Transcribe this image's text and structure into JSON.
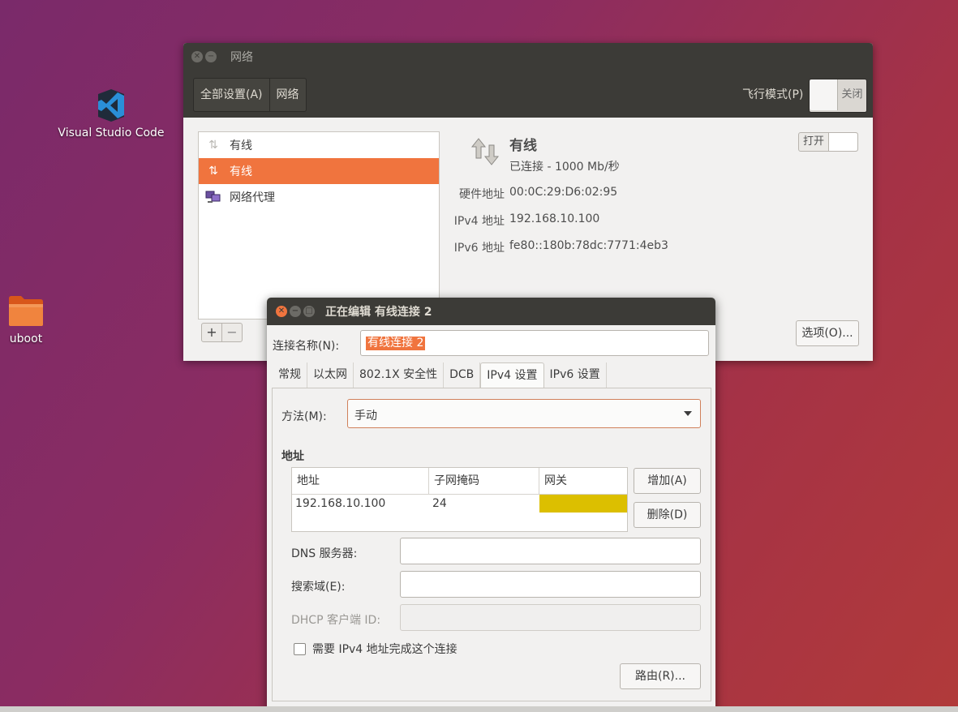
{
  "desktop": {
    "vscode_label": "Visual Studio Code",
    "uboot_label": "uboot"
  },
  "network_window": {
    "title": "网络",
    "breadcrumb": [
      "全部设置(A)",
      "网络"
    ],
    "airplane_label": "飞行模式(P)",
    "airplane_state": "关闭",
    "devices": [
      {
        "label": "有线",
        "icon": "wired-icon",
        "selected": false
      },
      {
        "label": "有线",
        "icon": "wired-icon",
        "selected": true
      },
      {
        "label": "网络代理",
        "icon": "proxy-icon",
        "selected": false
      }
    ],
    "add_symbol": "+",
    "remove_symbol": "−",
    "detail": {
      "title": "有线",
      "status": "已连接 - 1000 Mb/秒",
      "hw_label": "硬件地址",
      "hw_value": "00:0C:29:D6:02:95",
      "ipv4_label": "IPv4 地址",
      "ipv4_value": "192.168.10.100",
      "ipv6_label": "IPv6 地址",
      "ipv6_value": "fe80::180b:78dc:7771:4eb3",
      "switch_label": "打开",
      "options_button": "选项(O)..."
    }
  },
  "edit_dialog": {
    "title": "正在编辑 有线连接 2",
    "conn_name_label": "连接名称(N):",
    "conn_name_value": "有线连接 2",
    "tabs": [
      "常规",
      "以太网",
      "802.1X 安全性",
      "DCB",
      "IPv4 设置",
      "IPv6 设置"
    ],
    "active_tab": "IPv4 设置",
    "method_label": "方法(M):",
    "method_value": "手动",
    "address_heading": "地址",
    "table": {
      "headers": [
        "地址",
        "子网掩码",
        "网关"
      ],
      "rows": [
        [
          "192.168.10.100",
          "24",
          ""
        ]
      ]
    },
    "add_button": "增加(A)",
    "delete_button": "删除(D)",
    "dns_label": "DNS 服务器:",
    "search_label": "搜索域(E):",
    "dhcp_label": "DHCP 客户端 ID:",
    "require_ipv4_label": "需要 IPv4 地址完成这个连接",
    "route_button": "路由(R)..."
  },
  "colors": {
    "accent": "#f0743e",
    "titlebar": "#3c3b37",
    "highlight": "#dcbf00"
  }
}
